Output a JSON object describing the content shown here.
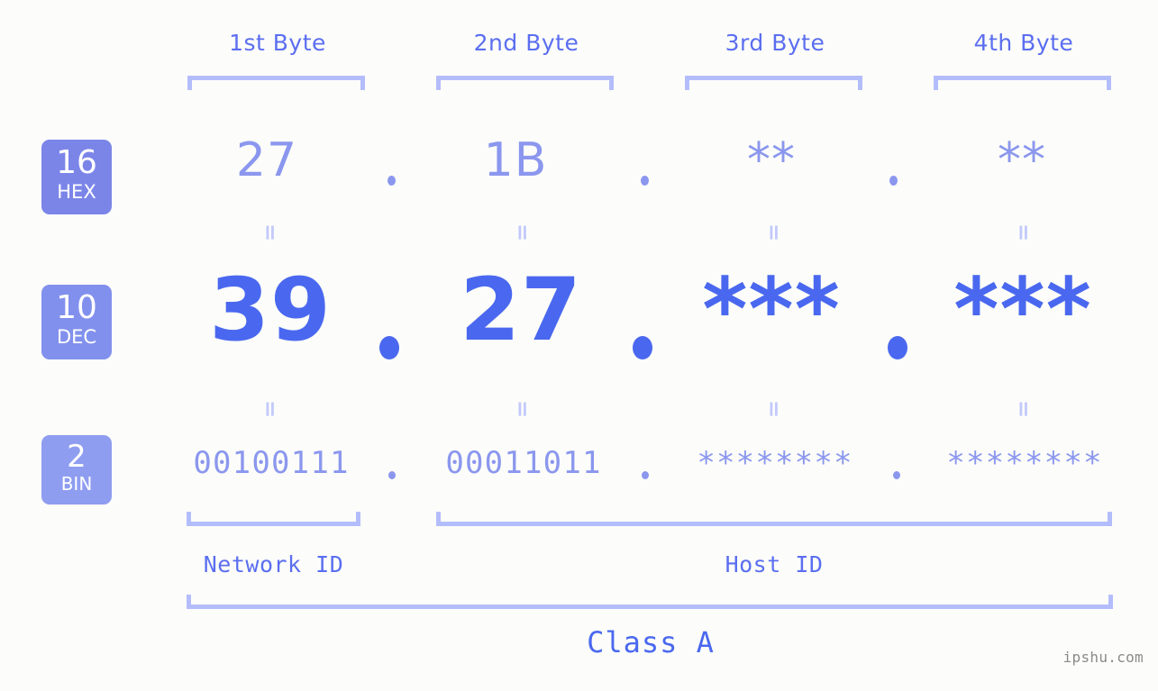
{
  "background_color": "#fcfdfa",
  "accent_colors": {
    "bracket": "#b4bdfb",
    "header_text": "#5b6ef0",
    "hex_text": "#8b97ee",
    "dec_text": "#4a68ef",
    "bin_text": "#8b97ee",
    "badge_hex_bg": "#7b85e8",
    "badge_dec_bg": "#8290ed",
    "badge_bin_bg": "#8e9df0",
    "equals_mark": "#c2c9fb",
    "watermark": "#8a8a8a"
  },
  "byte_headers": [
    {
      "label": "1st Byte"
    },
    {
      "label": "2nd Byte"
    },
    {
      "label": "3rd Byte"
    },
    {
      "label": "4th Byte"
    }
  ],
  "rows": {
    "hex": {
      "badge_number": "16",
      "badge_name": "HEX",
      "values": [
        "27",
        "1B",
        "**",
        "**"
      ],
      "separator": "."
    },
    "dec": {
      "badge_number": "10",
      "badge_name": "DEC",
      "values": [
        "39",
        "27",
        "***",
        "***"
      ],
      "separator": "."
    },
    "bin": {
      "badge_number": "2",
      "badge_name": "BIN",
      "values": [
        "00100111",
        "00011011",
        "********",
        "********"
      ],
      "separator": "."
    }
  },
  "equality_marks": {
    "symbol": "=",
    "upper_count": 4,
    "lower_count": 4
  },
  "id_sections": [
    {
      "label": "Network ID"
    },
    {
      "label": "Host ID"
    }
  ],
  "class_label": "Class A",
  "watermark": "ipshu.com"
}
